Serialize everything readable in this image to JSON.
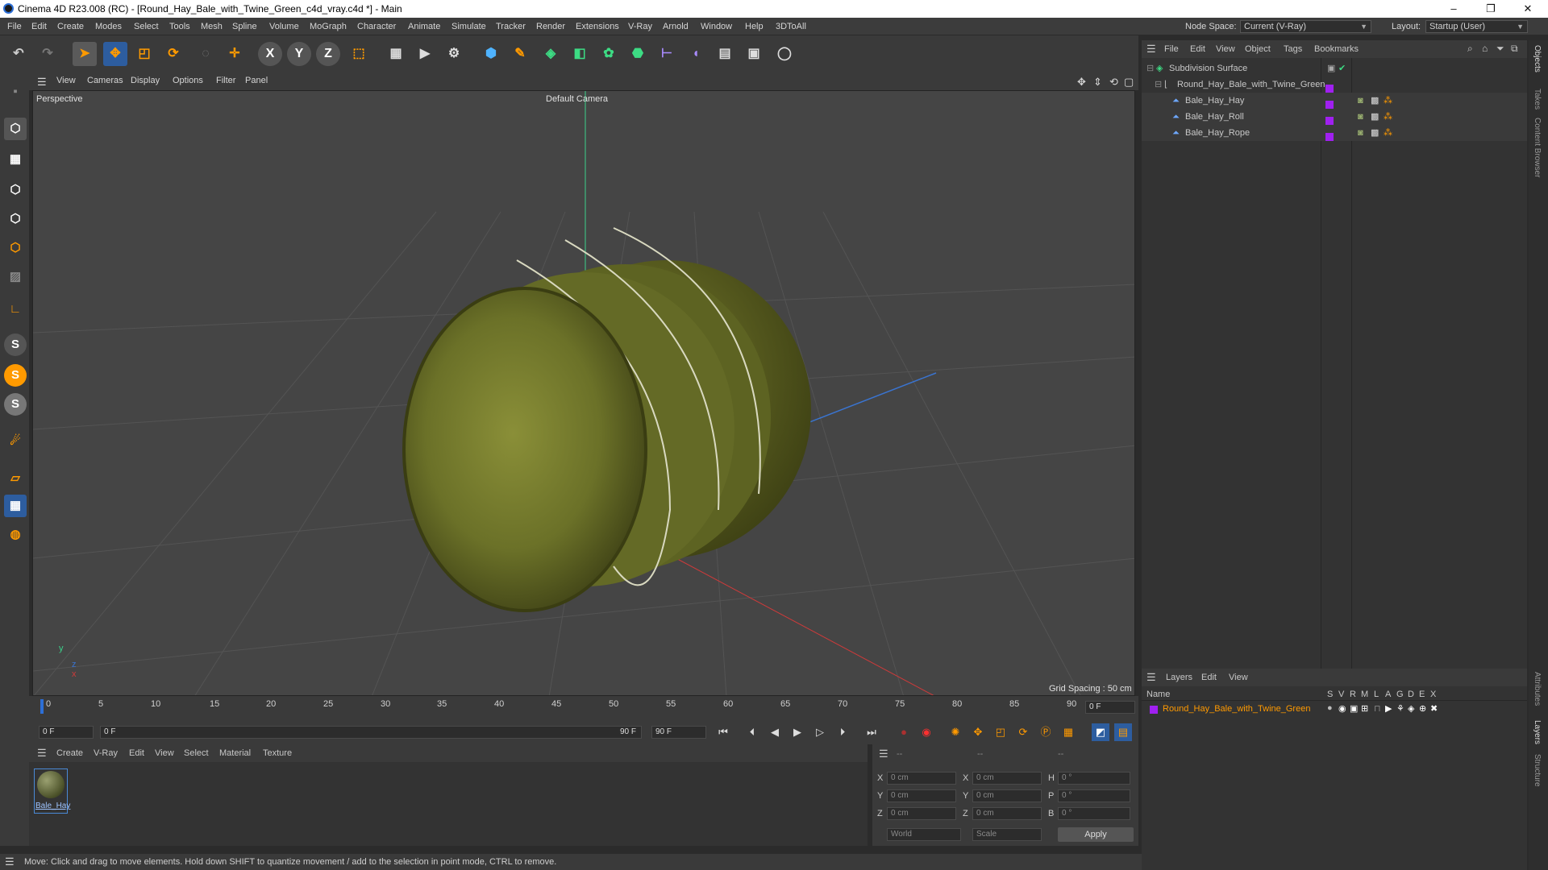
{
  "window": {
    "title": "Cinema 4D R23.008 (RC) - [Round_Hay_Bale_with_Twine_Green_c4d_vray.c4d *] - Main",
    "minimize": "–",
    "maximize": "❐",
    "close": "✕"
  },
  "menubar": {
    "items": [
      "File",
      "Edit",
      "Create",
      "Modes",
      "Select",
      "Tools",
      "Mesh",
      "Spline",
      "Volume",
      "MoGraph",
      "Character",
      "Animate",
      "Simulate",
      "Tracker",
      "Render",
      "Extensions",
      "V-Ray",
      "Arnold",
      "Window",
      "Help",
      "3DToAll"
    ],
    "node_space_label": "Node Space:",
    "node_space_value": "Current (V-Ray)",
    "layout_label": "Layout:",
    "layout_value": "Startup (User)"
  },
  "viewport_menu": {
    "items": [
      "View",
      "Cameras",
      "Display",
      "Options",
      "Filter",
      "Panel"
    ]
  },
  "viewport": {
    "name": "Perspective",
    "camera": "Default Camera",
    "grid_spacing": "Grid Spacing : 50 cm",
    "axis_y": "y",
    "axis_z": "z",
    "axis_x": "x"
  },
  "timeline": {
    "ticks": [
      "0",
      "5",
      "10",
      "15",
      "20",
      "25",
      "30",
      "35",
      "40",
      "45",
      "50",
      "55",
      "60",
      "65",
      "70",
      "75",
      "80",
      "85",
      "90"
    ],
    "current_frame": "0 F"
  },
  "playbar": {
    "start_field": "0 F",
    "range_start": "0 F",
    "range_end": "90 F",
    "end_field": "90 F"
  },
  "material_menu": {
    "items": [
      "Create",
      "V-Ray",
      "Edit",
      "View",
      "Select",
      "Material",
      "Texture"
    ],
    "material_name": "Bale_Hay"
  },
  "coords": {
    "header": [
      "--",
      "--",
      "--"
    ],
    "rows": [
      {
        "a": "X",
        "av": "0 cm",
        "b": "X",
        "bv": "0 cm",
        "c": "H",
        "cv": "0 °"
      },
      {
        "a": "Y",
        "av": "0 cm",
        "b": "Y",
        "bv": "0 cm",
        "c": "P",
        "cv": "0 °"
      },
      {
        "a": "Z",
        "av": "0 cm",
        "b": "Z",
        "bv": "0 cm",
        "c": "B",
        "cv": "0 °"
      }
    ],
    "mode": "World",
    "transform": "Scale",
    "apply": "Apply"
  },
  "object_manager": {
    "menu": [
      "File",
      "Edit",
      "View",
      "Object",
      "Tags",
      "Bookmarks"
    ],
    "objects": [
      {
        "name": "Subdivision Surface",
        "level": 0
      },
      {
        "name": "Round_Hay_Bale_with_Twine_Green",
        "level": 1
      },
      {
        "name": "Bale_Hay_Hay",
        "level": 2
      },
      {
        "name": "Bale_Hay_Roll",
        "level": 2
      },
      {
        "name": "Bale_Hay_Rope",
        "level": 2
      }
    ]
  },
  "layer_manager": {
    "menu": [
      "Layers",
      "Edit",
      "View"
    ],
    "name_header": "Name",
    "flag_headers": [
      "S",
      "V",
      "R",
      "M",
      "L",
      "A",
      "G",
      "D",
      "E",
      "X"
    ],
    "layer_name": "Round_Hay_Bale_with_Twine_Green",
    "layer_color": "#a020f0"
  },
  "side_tabs": [
    "Objects",
    "Takes",
    "Content Browser",
    "Attributes",
    "Layers",
    "Structure"
  ],
  "status": "Move: Click and drag to move elements. Hold down SHIFT to quantize movement / add to the selection in point mode, CTRL to remove.",
  "colors": {
    "accent": "#ff9a00",
    "layer_color": "#a020f0"
  }
}
